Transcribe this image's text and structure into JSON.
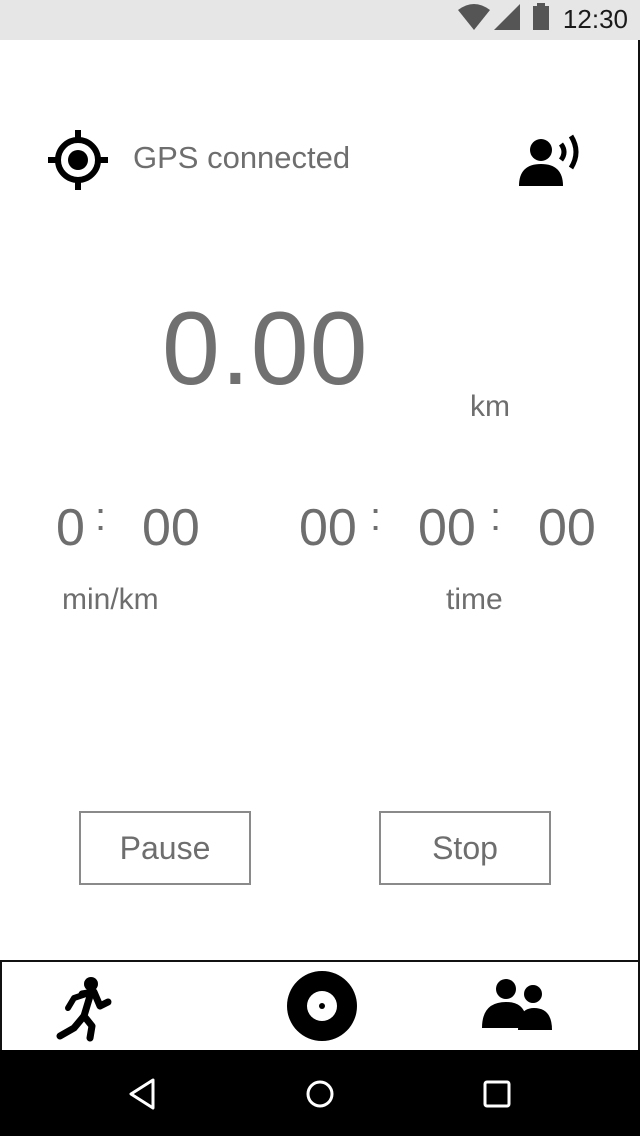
{
  "status_bar": {
    "time": "12:30",
    "icons": [
      "wifi-icon",
      "signal-icon",
      "battery-icon"
    ]
  },
  "header": {
    "gps_icon": "gps-crosshair-icon",
    "gps_status": "GPS connected",
    "voice_icon": "voice-guidance-icon"
  },
  "distance": {
    "value": "0.00",
    "unit": "km"
  },
  "pace": {
    "minutes": "0",
    "separator": ":",
    "seconds": "00",
    "label": "min/km"
  },
  "elapsed": {
    "hours": "00",
    "separator": ":",
    "minutes": "00",
    "seconds": "00",
    "label": "time"
  },
  "actions": {
    "pause_label": "Pause",
    "stop_label": "Stop"
  },
  "tab_bar": {
    "tabs": [
      "running-icon",
      "record-icon",
      "friends-icon"
    ]
  },
  "nav_bar": {
    "buttons": [
      "back-icon",
      "home-icon",
      "recents-icon"
    ]
  },
  "colors": {
    "text": "#6e6e6e",
    "status_bar_bg": "#e6e6e6",
    "nav_bar_bg": "#000000"
  }
}
